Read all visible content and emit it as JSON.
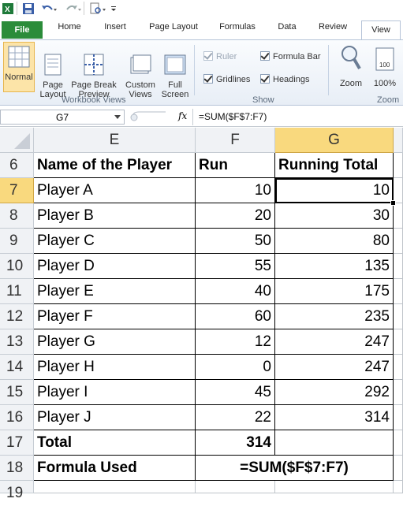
{
  "ribbon": {
    "tabs": [
      "File",
      "Home",
      "Insert",
      "Page Layout",
      "Formulas",
      "Data",
      "Review",
      "View"
    ],
    "active_tab": "View",
    "workbook_views": {
      "normal": "Normal",
      "page_layout": "Page\nLayout",
      "page_break": "Page Break\nPreview",
      "custom": "Custom\nViews",
      "full": "Full\nScreen",
      "group_label": "Workbook Views"
    },
    "show": {
      "ruler": "Ruler",
      "formula_bar": "Formula Bar",
      "gridlines": "Gridlines",
      "headings": "Headings",
      "group_label": "Show"
    },
    "zoom": {
      "zoom": "Zoom",
      "hundred": "100%",
      "group_label": "Zoom"
    }
  },
  "formula_bar": {
    "name_box": "G7",
    "fx": "fx",
    "formula": "=SUM($F$7:F7)"
  },
  "columns": [
    "E",
    "F",
    "G"
  ],
  "rows": [
    {
      "n": "6",
      "e": "Name of the Player",
      "f": "Run",
      "g": "Running Total"
    },
    {
      "n": "7",
      "e": "Player A",
      "f": "10",
      "g": "10"
    },
    {
      "n": "8",
      "e": "Player B",
      "f": "20",
      "g": "30"
    },
    {
      "n": "9",
      "e": "Player C",
      "f": "50",
      "g": "80"
    },
    {
      "n": "10",
      "e": "Player D",
      "f": "55",
      "g": "135"
    },
    {
      "n": "11",
      "e": "Player E",
      "f": "40",
      "g": "175"
    },
    {
      "n": "12",
      "e": "Player F",
      "f": "60",
      "g": "235"
    },
    {
      "n": "13",
      "e": "Player G",
      "f": "12",
      "g": "247"
    },
    {
      "n": "14",
      "e": "Player H",
      "f": "0",
      "g": "247"
    },
    {
      "n": "15",
      "e": "Player I",
      "f": "45",
      "g": "292"
    },
    {
      "n": "16",
      "e": "Player J",
      "f": "22",
      "g": "314"
    },
    {
      "n": "17",
      "e": "Total",
      "f": "314",
      "g": ""
    },
    {
      "n": "18",
      "e": "Formula Used",
      "f": "=SUM($F$7:F7)",
      "g": ""
    },
    {
      "n": "19",
      "e": "",
      "f": "",
      "g": ""
    }
  ]
}
